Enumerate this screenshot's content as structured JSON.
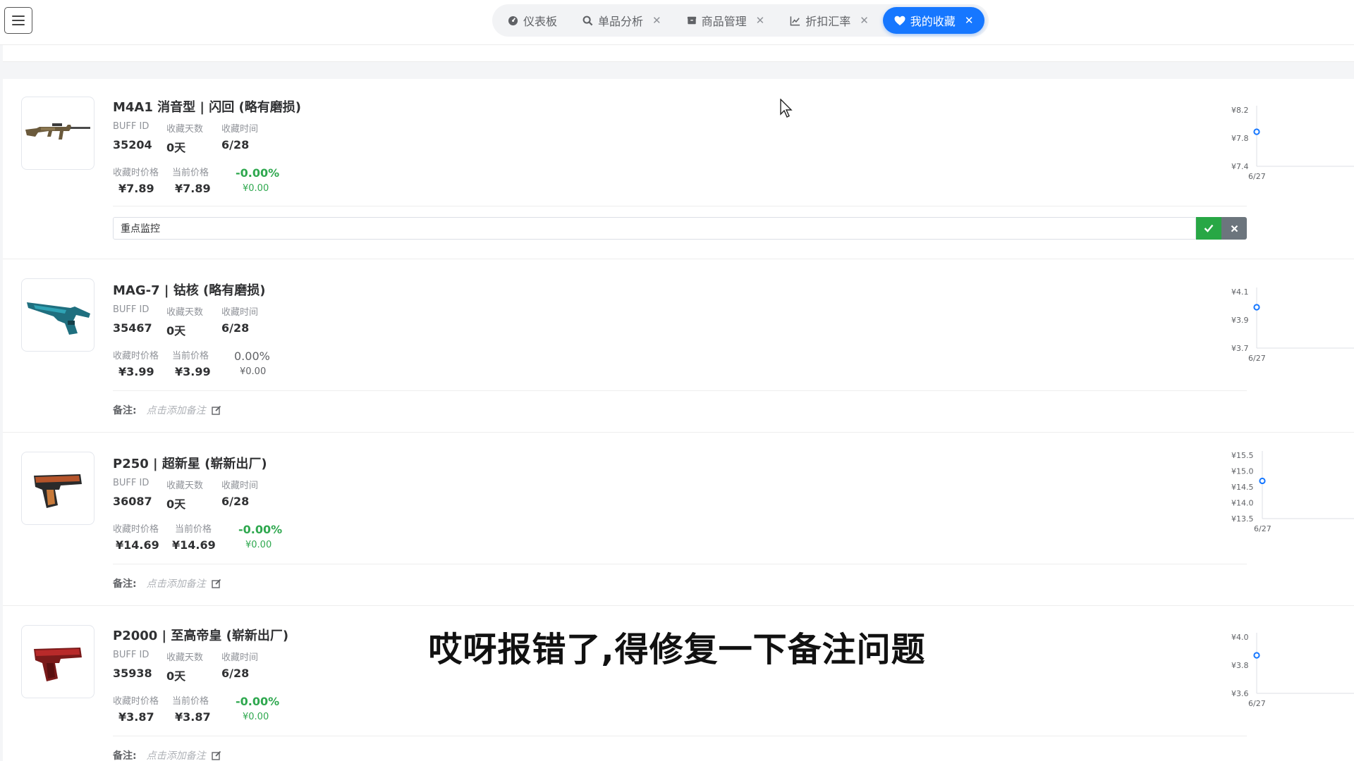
{
  "header": {
    "tabs": [
      {
        "label": "仪表板",
        "icon": "dashboard-icon",
        "closable": false,
        "active": false
      },
      {
        "label": "单品分析",
        "icon": "search-icon",
        "closable": true,
        "active": false
      },
      {
        "label": "商品管理",
        "icon": "box-icon",
        "closable": true,
        "active": false
      },
      {
        "label": "折扣汇率",
        "icon": "line-chart-icon",
        "closable": true,
        "active": false
      },
      {
        "label": "我的收藏",
        "icon": "heart-icon",
        "closable": true,
        "active": true
      }
    ],
    "accent_color": "#1677ff"
  },
  "labels": {
    "buff_id": "BUFF ID",
    "fav_days": "收藏天数",
    "fav_time": "收藏时间",
    "fav_price": "收藏时价格",
    "cur_price": "当前价格",
    "note": "备注:",
    "note_placeholder": "点击添加备注"
  },
  "items": [
    {
      "name": "M4A1 消音型 | 闪回 (略有磨损)",
      "buff_id": "35204",
      "days": "0天",
      "date": "6/28",
      "fav_price": "¥7.89",
      "cur_price": "¥7.89",
      "change_pct": "-0.00%",
      "change_amt": "¥0.00",
      "trend": "green",
      "note_editing": true,
      "note_value": "重点监控",
      "chart": {
        "y_ticks": [
          "¥8.2",
          "¥7.8",
          "¥7.4"
        ],
        "x_tick": "6/27",
        "point": 7.89,
        "ylim": [
          7.4,
          8.2
        ]
      }
    },
    {
      "name": "MAG-7 | 钴核 (略有磨损)",
      "buff_id": "35467",
      "days": "0天",
      "date": "6/28",
      "fav_price": "¥3.99",
      "cur_price": "¥3.99",
      "change_pct": "0.00%",
      "change_amt": "¥0.00",
      "trend": "gray",
      "note_editing": false,
      "note_value": "",
      "chart": {
        "y_ticks": [
          "¥4.1",
          "¥3.9",
          "¥3.7"
        ],
        "x_tick": "6/27",
        "point": 3.99,
        "ylim": [
          3.7,
          4.1
        ]
      }
    },
    {
      "name": "P250 | 超新星 (崭新出厂)",
      "buff_id": "36087",
      "days": "0天",
      "date": "6/28",
      "fav_price": "¥14.69",
      "cur_price": "¥14.69",
      "change_pct": "-0.00%",
      "change_amt": "¥0.00",
      "trend": "green",
      "note_editing": false,
      "note_value": "",
      "chart": {
        "y_ticks": [
          "¥15.5",
          "¥15.0",
          "¥14.5",
          "¥14.0",
          "¥13.5"
        ],
        "x_tick": "6/27",
        "point": 14.69,
        "ylim": [
          13.5,
          15.5
        ]
      }
    },
    {
      "name": "P2000 | 至高帝皇 (崭新出厂)",
      "buff_id": "35938",
      "days": "0天",
      "date": "6/28",
      "fav_price": "¥3.87",
      "cur_price": "¥3.87",
      "change_pct": "-0.00%",
      "change_amt": "¥0.00",
      "trend": "green",
      "note_editing": false,
      "note_value": "",
      "chart": {
        "y_ticks": [
          "¥4.0",
          "¥3.8",
          "¥3.6"
        ],
        "x_tick": "6/27",
        "point": 3.87,
        "ylim": [
          3.6,
          4.0
        ]
      }
    }
  ],
  "caption": "哎呀报错了,得修复一下备注问题"
}
